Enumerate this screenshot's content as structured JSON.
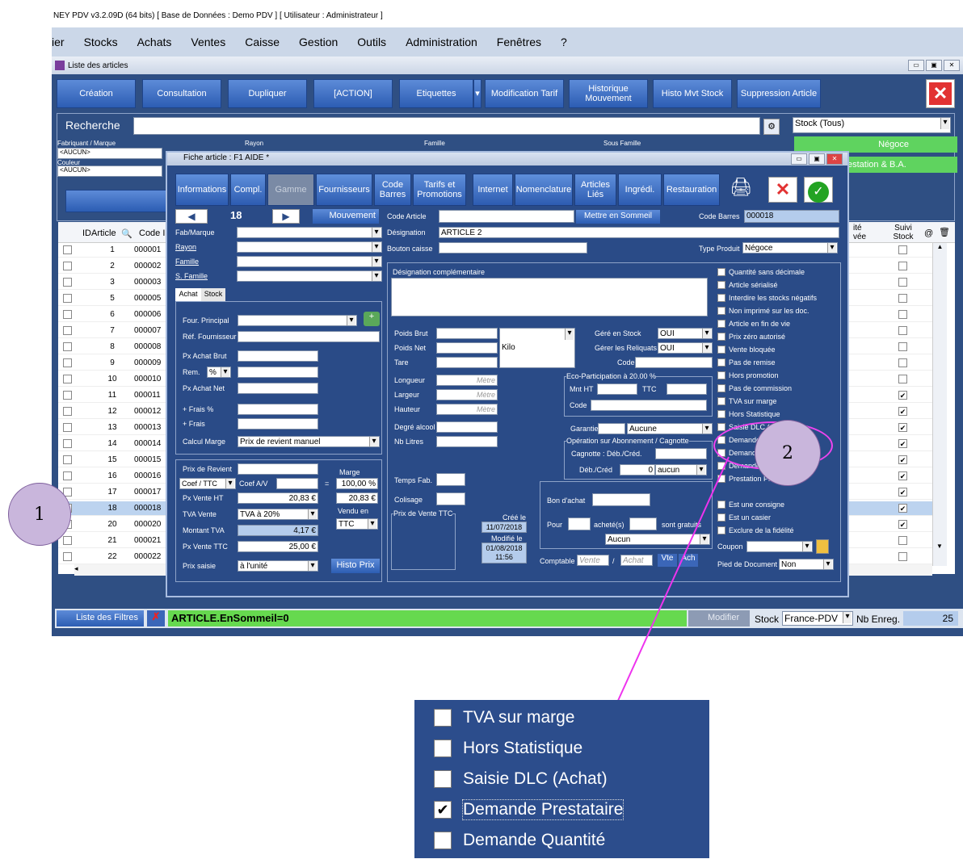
{
  "window_title": "NEY PDV v3.2.09D (64 bits) [ Base de Données : Demo PDV ] [ Utilisateur : Administrateur ]",
  "menu": [
    "ier",
    "Stocks",
    "Achats",
    "Ventes",
    "Caisse",
    "Gestion",
    "Outils",
    "Administration",
    "Fenêtres",
    "?"
  ],
  "list_window_title": "Liste des articles",
  "toolbar": [
    "Création",
    "Consultation",
    "Dupliquer",
    "[ACTION]",
    "Etiquettes",
    "Modification Tarif",
    "Historique Mouvement",
    "Histo Mvt Stock",
    "Suppression Article"
  ],
  "search": {
    "label": "Recherche",
    "stock_filter": "Stock (Tous)",
    "negoce": "Négoce",
    "prestation": "estation & B.A."
  },
  "filters": {
    "fab_label": "Fabriquant / Marque",
    "fab_value": "<AUCUN>",
    "couleur_label": "Couleur",
    "couleur_value": "<AUCUN>",
    "rayon": "Rayon",
    "famille": "Famille",
    "sous_famille": "Sous Famille"
  },
  "grid": {
    "col_id": "IDArticle",
    "col_code": "Code I",
    "col_qte": "ité vée",
    "col_suivi": "Suivi Stock",
    "col_at": "@",
    "rows": [
      {
        "id": "1",
        "code": "000001",
        "chk": false
      },
      {
        "id": "2",
        "code": "000002",
        "chk": false
      },
      {
        "id": "3",
        "code": "000003",
        "chk": false
      },
      {
        "id": "5",
        "code": "000005",
        "chk": false
      },
      {
        "id": "6",
        "code": "000006",
        "chk": false
      },
      {
        "id": "7",
        "code": "000007",
        "chk": false
      },
      {
        "id": "8",
        "code": "000008",
        "chk": false
      },
      {
        "id": "9",
        "code": "000009",
        "chk": false
      },
      {
        "id": "10",
        "code": "000010",
        "chk": false
      },
      {
        "id": "11",
        "code": "000011",
        "chk": true
      },
      {
        "id": "12",
        "code": "000012",
        "chk": true
      },
      {
        "id": "13",
        "code": "000013",
        "chk": true
      },
      {
        "id": "14",
        "code": "000014",
        "chk": true
      },
      {
        "id": "15",
        "code": "000015",
        "chk": true
      },
      {
        "id": "16",
        "code": "000016",
        "chk": true
      },
      {
        "id": "17",
        "code": "000017",
        "chk": true
      },
      {
        "id": "18",
        "code": "000018",
        "chk": true
      },
      {
        "id": "20",
        "code": "000020",
        "chk": true
      },
      {
        "id": "21",
        "code": "000021",
        "chk": false
      },
      {
        "id": "22",
        "code": "000022",
        "chk": false
      }
    ]
  },
  "status": {
    "filters_btn": "Liste des Filtres",
    "filter_text": "ARTICLE.EnSommeil=0",
    "modifier": "Modifier",
    "stock_label": "Stock",
    "stock_value": "France-PDV",
    "nb_label": "Nb Enreg.",
    "nb_value": "25"
  },
  "fiche": {
    "title": "Fiche article : F1 AIDE *",
    "tabs": [
      "Informations",
      "Compl.",
      "Gamme",
      "Fournisseurs",
      "Code Barres",
      "Tarifs et Promotions",
      "Internet",
      "Nomenclature",
      "Articles Liés",
      "Ingrédi.",
      "Restauration"
    ],
    "nav_number": "18",
    "mouvement": "Mouvement",
    "code_article_lbl": "Code Article",
    "mettre_sommeil": "Mettre en Sommeil",
    "code_barres_lbl": "Code Barres",
    "code_barres": "000018",
    "fab_lbl": "Fab/Marque",
    "rayon_lbl": "Rayon",
    "famille_lbl": "Famille",
    "sfamille_lbl": "S. Famille",
    "designation_lbl": "Désignation",
    "designation": "ARTICLE 2",
    "bouton_caisse_lbl": "Bouton caisse",
    "type_produit_lbl": "Type Produit",
    "type_produit": "Négoce",
    "subtab_achat": "Achat",
    "subtab_stock": "Stock",
    "four_principal": "Four. Principal",
    "ref_fourn": "Réf. Fournisseur",
    "px_achat_brut": "Px Achat Brut",
    "rem": "Rem.",
    "rem_unit": "%",
    "px_achat_net": "Px Achat Net",
    "frais_pct": "+ Frais %",
    "frais": "+ Frais",
    "calcul_marge": "Calcul Marge",
    "calcul_marge_val": "Prix de revient manuel",
    "prix_revient": "Prix de Revient",
    "marge": "Marge",
    "coef_sel": "Coef / TTC",
    "coef_av": "Coef A/V",
    "eq": "=",
    "marge_val": "100,00 %",
    "px_vente_ht": "Px Vente HT",
    "px_vente_ht_val": "20,83 €",
    "px_vente_ht_val2": "20,83 €",
    "tva_vente": "TVA Vente",
    "tva_val": "TVA à 20%",
    "vendu_en": "Vendu en",
    "vendu_val": "TTC",
    "montant_tva": "Montant TVA",
    "montant_tva_val": "4,17 €",
    "px_vente_ttc": "Px Vente TTC",
    "px_vente_ttc_val": "25,00 €",
    "prix_saisie": "Prix saisie",
    "prix_saisie_val": "à l'unité",
    "histo_prix": "Histo Prix",
    "desig_compl": "Désignation complémentaire",
    "poids_brut": "Poids Brut",
    "poids_net": "Poids Net",
    "tare": "Tare",
    "unit": "Kilo",
    "longueur": "Longueur",
    "largeur": "Largeur",
    "hauteur": "Hauteur",
    "metre": "Mètre",
    "degre": "Degré alcool",
    "nb_litres": "Nb Litres",
    "gere_stock": "Géré en Stock",
    "gere_stock_val": "OUI",
    "gerer_reliquats": "Gérer les Reliquats",
    "gerer_reliquats_val": "OUI",
    "code_geo": "Code Géo.",
    "eco_title": "Eco-Participation à 20.00 %",
    "mnt_ht": "Mnt HT",
    "ttc": "TTC",
    "code": "Code",
    "garantie": "Garantie",
    "garantie_val": "Aucune",
    "abo_title": "Opération sur Abonnement / Cagnotte",
    "cagnotte": "Cagnotte : Déb./Créd.",
    "deb_cred": "Déb./Créd",
    "deb_val": "0",
    "deb_sel": "aucun",
    "temps_fab": "Temps Fab.",
    "colisage": "Colisage",
    "pvttc_title": "Prix de Vente TTC",
    "cree_le": "Créé le",
    "cree_date": "11/07/2018",
    "modifie_le": "Modifié le",
    "modifie_date": "01/08/2018",
    "modifie_time": "11:56",
    "bon_achat": "Bon d'achat",
    "pour": "Pour",
    "achetes": "acheté(s)",
    "gratuits": "sont gratuits",
    "aucun": "Aucun",
    "comptable": "Comptable",
    "vente_ph": "Vente",
    "slash": "/",
    "achat_ph": "Achat",
    "vte": "Vte",
    "ach": "Ach",
    "checkboxes": [
      {
        "label": "Quantité sans décimale",
        "checked": false
      },
      {
        "label": "Article sérialisé",
        "checked": false
      },
      {
        "label": "Interdire les stocks négatifs",
        "checked": false
      },
      {
        "label": "Non imprimé sur les doc.",
        "checked": false
      },
      {
        "label": "Article en fin de vie",
        "checked": false
      },
      {
        "label": "Prix zéro autorisé",
        "checked": false
      },
      {
        "label": "Vente bloquée",
        "checked": false
      },
      {
        "label": "Pas de remise",
        "checked": false
      },
      {
        "label": "Hors promotion",
        "checked": false
      },
      {
        "label": "Pas de commission",
        "checked": false
      },
      {
        "label": "TVA sur marge",
        "checked": false
      },
      {
        "label": "Hors Statistique",
        "checked": false
      },
      {
        "label": "Saisie DLC (Achat)",
        "checked": false
      },
      {
        "label": "Demande Prestataire",
        "checked": true
      },
      {
        "label": "Demande Quantité",
        "checked": false
      },
      {
        "label": "Demande ...",
        "checked": false
      },
      {
        "label": "Prestation Planning",
        "checked": false
      }
    ],
    "checkboxes2": [
      {
        "label": "Est une consigne",
        "checked": false
      },
      {
        "label": "Est un casier",
        "checked": false
      },
      {
        "label": "Exclure de la fidélité",
        "checked": false
      }
    ],
    "coupon": "Coupon",
    "pied_doc": "Pied de Document",
    "pied_val": "Non"
  },
  "callouts": {
    "one": "1",
    "two": "2"
  },
  "zoom": [
    {
      "label": "TVA sur marge",
      "checked": false
    },
    {
      "label": "Hors Statistique",
      "checked": false
    },
    {
      "label": "Saisie DLC (Achat)",
      "checked": false
    },
    {
      "label": "Demande Prestataire",
      "checked": true
    },
    {
      "label": "Demande Quantité",
      "checked": false
    }
  ]
}
